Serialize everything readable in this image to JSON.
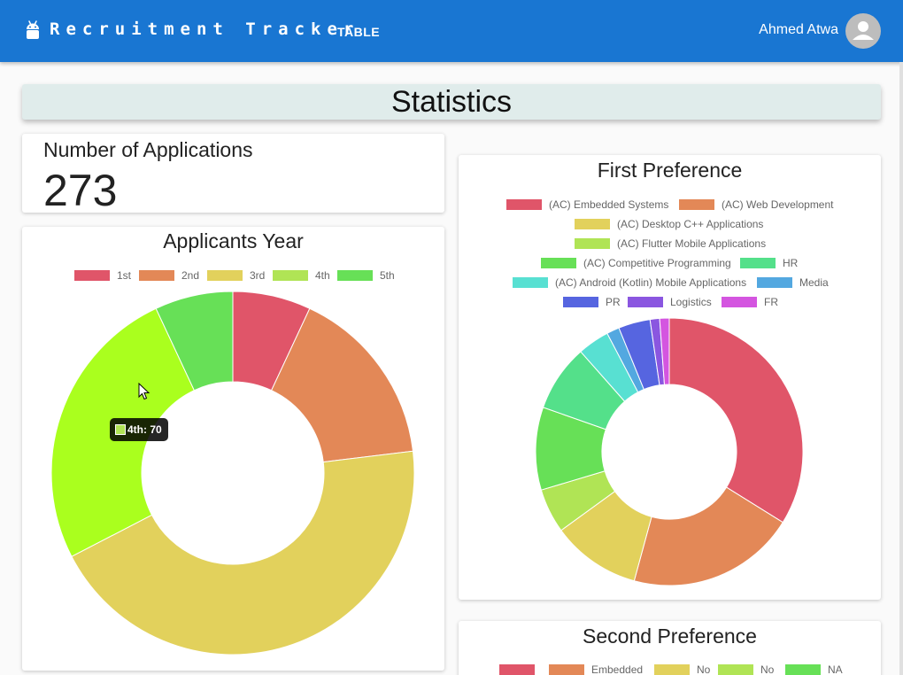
{
  "appbar": {
    "brand": "Recruitment Tracker",
    "nav_table": "TABLE",
    "user_name": "Ahmed Atwa",
    "logo_icon": "android-icon",
    "avatar_icon": "account-icon",
    "color": "#1976d2"
  },
  "page": {
    "title": "Statistics"
  },
  "applications": {
    "label": "Number of Applications",
    "value": "273"
  },
  "tooltip": {
    "text": "4th: 70",
    "swatch_color": "#b0e455"
  },
  "chart_data": [
    {
      "type": "doughnut",
      "title": "Applicants Year",
      "legend_position": "top",
      "categories": [
        "1st",
        "2nd",
        "3rd",
        "4th",
        "5th"
      ],
      "values": [
        19,
        44,
        121,
        70,
        19
      ],
      "colors": [
        "#e05569",
        "#e38857",
        "#e2d15c",
        "#b0e455",
        "#67e057"
      ],
      "highlighted": {
        "index": 3,
        "color": "#aaff1e"
      }
    },
    {
      "type": "doughnut",
      "title": "First Preference",
      "legend_position": "top",
      "categories": [
        "(AC) Embedded Systems",
        "(AC) Web Development",
        "(AC) Desktop C++ Applications",
        "(AC) Flutter Mobile Applications",
        "(AC) Competitive Programming",
        "HR",
        "(AC) Android (Kotlin) Mobile Applications",
        "Media",
        "PR",
        "Logistics",
        "FR"
      ],
      "values": [
        88,
        53,
        28,
        14,
        26,
        21,
        10,
        4,
        10,
        3,
        3
      ],
      "colors": [
        "#e05569",
        "#e38857",
        "#e2d15c",
        "#b0e455",
        "#67e057",
        "#54e08a",
        "#58e0d2",
        "#53a8e0",
        "#5665e0",
        "#8a56e0",
        "#d455e0"
      ]
    },
    {
      "type": "doughnut",
      "title": "Second Preference",
      "legend_position": "top",
      "categories": [
        "",
        "Embedded",
        "No",
        "No",
        "NA"
      ],
      "colors": [
        "#e05569",
        "#e38857",
        "#e2d15c",
        "#b0e455",
        "#67e057"
      ]
    }
  ]
}
